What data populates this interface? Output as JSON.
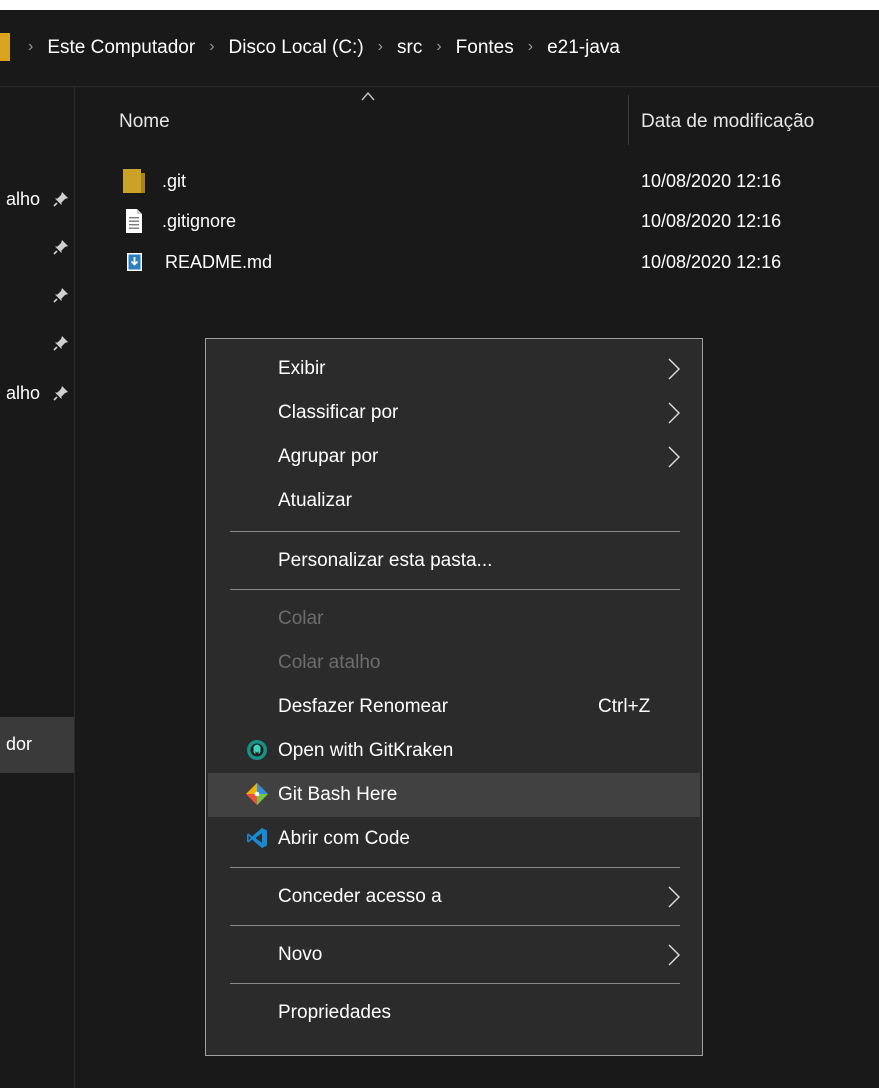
{
  "breadcrumb": [
    "Este Computador",
    "Disco Local (C:)",
    "src",
    "Fontes",
    "e21-java"
  ],
  "nav": {
    "quick_access_rows": [
      {
        "label": "alho",
        "pinned": true
      },
      {
        "label": "",
        "pinned": true
      },
      {
        "label": "",
        "pinned": true
      },
      {
        "label": "",
        "pinned": true
      },
      {
        "label": "alho",
        "pinned": true
      }
    ],
    "selected_label": "dor"
  },
  "columns": {
    "name": "Nome",
    "date": "Data de modificação"
  },
  "files": [
    {
      "name": ".git",
      "date": "10/08/2020 12:16",
      "icon": "folder-icon"
    },
    {
      "name": ".gitignore",
      "date": "10/08/2020 12:16",
      "icon": "text-file-icon"
    },
    {
      "name": "README.md",
      "date": "10/08/2020 12:16",
      "icon": "markdown-file-icon"
    }
  ],
  "context_menu": {
    "exibir": "Exibir",
    "classificar": "Classificar por",
    "agrupar": "Agrupar por",
    "atualizar": "Atualizar",
    "personalizar": "Personalizar esta pasta...",
    "colar": "Colar",
    "colar_atalho": "Colar atalho",
    "desfazer": "Desfazer Renomear",
    "desfazer_shortcut": "Ctrl+Z",
    "gitkraken": "Open with GitKraken",
    "gitbash": "Git Bash Here",
    "code": "Abrir com Code",
    "conceder": "Conceder acesso a",
    "novo": "Novo",
    "propriedades": "Propriedades"
  },
  "colors": {
    "background": "#191919",
    "menu_background": "#2b2b2b",
    "menu_highlight": "#414141",
    "disabled_text": "#6d6d6d",
    "folder": "#c9a227",
    "vscode_blue": "#1a8ad4"
  }
}
